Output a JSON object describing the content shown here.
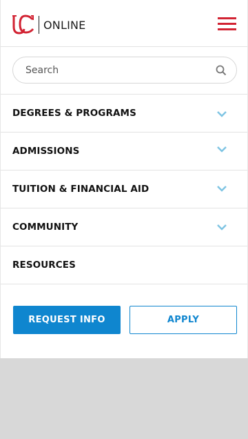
{
  "header": {
    "logo_text": "ONLINE",
    "logo_mark": "UC",
    "menu_icon": "hamburger-icon",
    "brand_color": "#d22333"
  },
  "search": {
    "placeholder": "Search",
    "icon": "search-icon"
  },
  "nav": {
    "items": [
      {
        "label": "DEGREES & PROGRAMS",
        "has_chevron": true
      },
      {
        "label": "ADMISSIONS",
        "has_chevron": true
      },
      {
        "label": "TUITION & FINANCIAL AID",
        "has_chevron": true
      },
      {
        "label": "COMMUNITY",
        "has_chevron": true
      },
      {
        "label": "RESOURCES",
        "has_chevron": false
      }
    ],
    "chevron_color": "#7fc4e3"
  },
  "actions": {
    "request_info_label": "REQUEST INFO",
    "apply_label": "APPLY",
    "accent_color": "#0f86cf"
  }
}
